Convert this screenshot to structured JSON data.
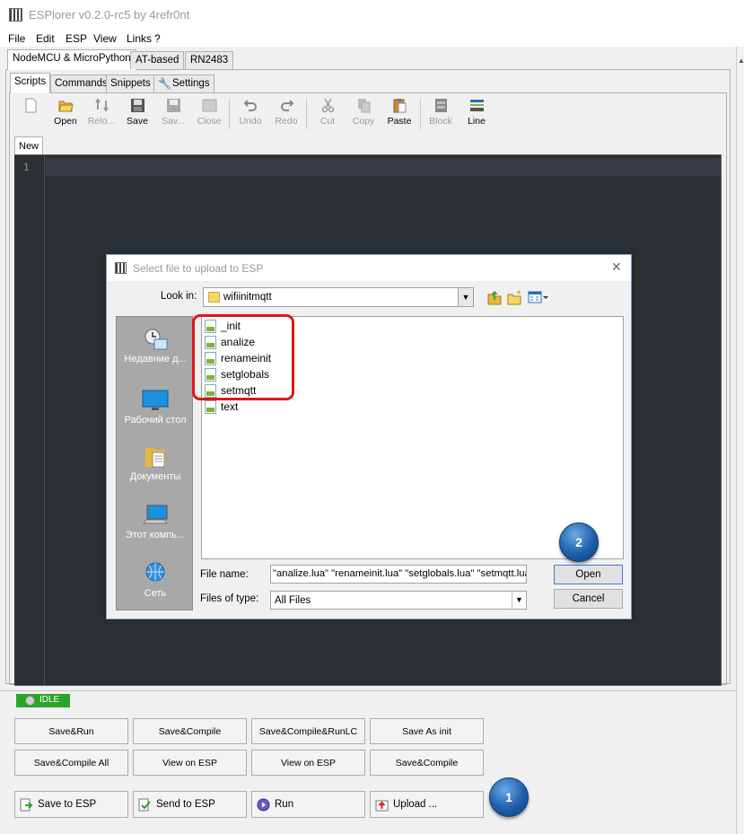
{
  "window": {
    "title": "ESPlorer v0.2.0-rc5 by 4refr0nt"
  },
  "menu": [
    "File",
    "Edit",
    "ESP",
    "View",
    "Links",
    "?"
  ],
  "main_tabs": [
    "NodeMCU & MicroPython",
    "AT-based",
    "RN2483"
  ],
  "sub_tabs": [
    "Scripts",
    "Commands",
    "Snippets",
    "Settings"
  ],
  "toolbar": {
    "open": "Open",
    "reload": "Relo...",
    "save": "Save",
    "saveas": "Sav...",
    "close": "Close",
    "undo": "Undo",
    "redo": "Redo",
    "cut": "Cut",
    "copy": "Copy",
    "paste": "Paste",
    "block": "Block",
    "line": "Line"
  },
  "editor": {
    "file_tab": "New",
    "line_number": "1"
  },
  "dialog": {
    "title": "Select file to upload to ESP",
    "look_in_label": "Look in:",
    "look_in_value": "wifiinitmqtt",
    "places": [
      "Недавние д...",
      "Рабочий стол",
      "Документы",
      "Этот компь...",
      "Сеть"
    ],
    "files": [
      "_init",
      "analize",
      "renameinit",
      "setglobals",
      "setmqtt",
      "text"
    ],
    "file_name_label": "File name:",
    "file_name_value": "\"analize.lua\" \"renameinit.lua\" \"setglobals.lua\" \"setmqtt.lua\"",
    "files_of_type_label": "Files of type:",
    "files_of_type_value": "All Files",
    "open_button": "Open",
    "cancel_button": "Cancel"
  },
  "status": {
    "state": "IDLE"
  },
  "buttons_row1": [
    "Save&Run",
    "Save&Compile",
    "Save&Compile&RunLC",
    "Save As init"
  ],
  "buttons_row2": [
    "Save&Compile All",
    "View on ESP",
    "View on ESP",
    "Save&Compile"
  ],
  "buttons_row3": [
    "Save to ESP",
    "Send to ESP",
    "Run",
    "Upload ..."
  ],
  "annotations": {
    "step1": "1",
    "step2": "2"
  },
  "colors": {
    "highlight": "#e0151b",
    "idle": "#2aa52a",
    "editor_bg": "#2b3034",
    "marker": "#1f5fa8"
  }
}
